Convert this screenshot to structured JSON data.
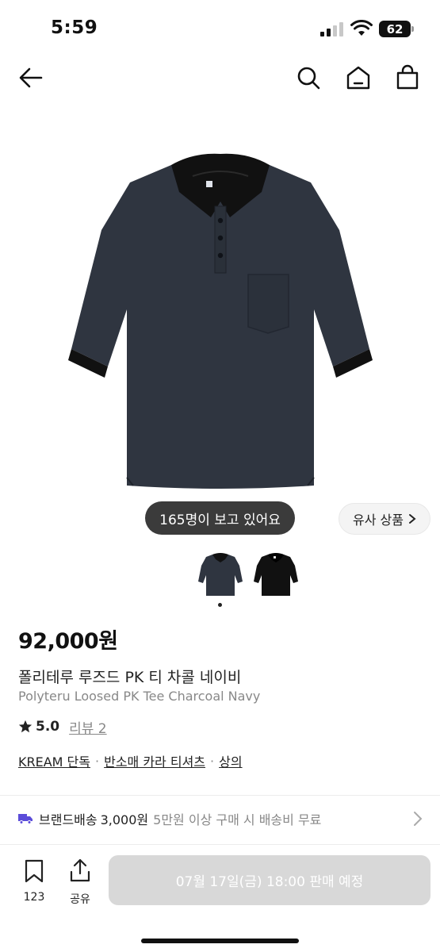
{
  "status_bar": {
    "time": "5:59",
    "battery": "62"
  },
  "nav": {
    "back_icon": "back-arrow-icon",
    "search_icon": "search-icon",
    "home_icon": "home-icon",
    "bag_icon": "shopping-bag-icon"
  },
  "hero": {
    "viewers_text": "165명이 보고 있어요",
    "similar_label": "유사 상품"
  },
  "product": {
    "price": "92,000원",
    "name_ko": "폴리테루 루즈드 PK 티 차콜 네이비",
    "name_en": "Polyteru Loosed PK Tee Charcoal Navy",
    "rating": "5.0",
    "review_label": "리뷰 2",
    "tags": [
      "KREAM 단독",
      "반소매 카라 티셔츠",
      "상의"
    ],
    "tag_separator": "·"
  },
  "shipping": {
    "label": "브랜드배송",
    "fee": "3,000원",
    "note": "5만원 이상 구매 시 배송비 무료"
  },
  "bottom_bar": {
    "bookmark_count": "123",
    "share_label": "공유",
    "cta_label": "07월 17일(금) 18:00 판매 예정"
  },
  "colors": {
    "cta_disabled": "#d8d8d8",
    "shirt_navy": "#2f3540",
    "shirt_black": "#111111",
    "shipping_icon": "#5b4cd9"
  }
}
